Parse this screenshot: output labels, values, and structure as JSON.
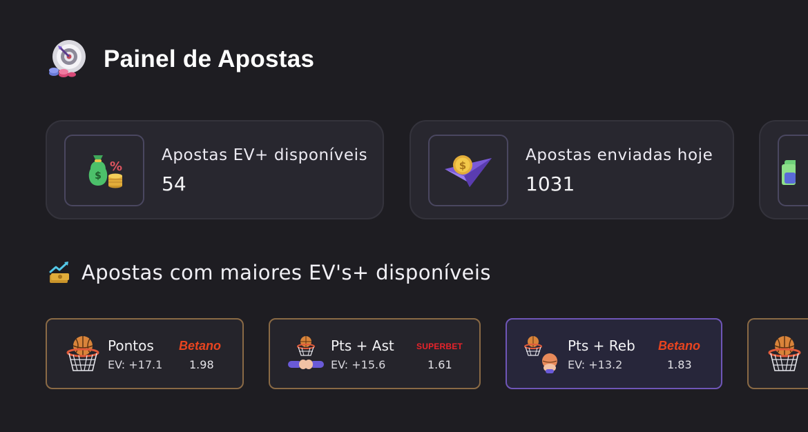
{
  "header": {
    "title": "Painel de Apostas",
    "icon": "target-dart-icon"
  },
  "stats": [
    {
      "label": "Apostas EV+ disponíveis",
      "value": "54",
      "icon": "money-bag-percent-icon"
    },
    {
      "label": "Apostas enviadas hoje",
      "value": "1031",
      "icon": "paper-plane-coin-icon"
    },
    {
      "label": "",
      "value": "",
      "icon": "cash-stack-icon"
    }
  ],
  "section": {
    "title": "Apostas com maiores EV's+ disponíveis",
    "icon": "chart-growth-icon"
  },
  "bets": [
    {
      "market": "Pontos",
      "ev": "EV: +17.1",
      "bookmaker": "Betano",
      "odds": "1.98",
      "icon": "basketball-hoop-icon",
      "highlight": false
    },
    {
      "market": "Pts + Ast",
      "ev": "EV: +15.6",
      "bookmaker": "SUPERBET",
      "odds": "1.61",
      "icon": "hoop-assist-icon",
      "highlight": false
    },
    {
      "market": "Pts + Reb",
      "ev": "EV: +13.2",
      "bookmaker": "Betano",
      "odds": "1.83",
      "icon": "hoop-rebound-icon",
      "highlight": true
    },
    {
      "market": "",
      "ev": "",
      "bookmaker": "",
      "odds": "",
      "icon": "basketball-hoop-icon",
      "highlight": false
    }
  ],
  "colors": {
    "background": "#1e1d22",
    "card": "#28272f",
    "bet_border": "#8a6a45",
    "bet_border_highlight": "#6f56b8",
    "betano": "#e8441f",
    "superbet": "#e9232b"
  }
}
